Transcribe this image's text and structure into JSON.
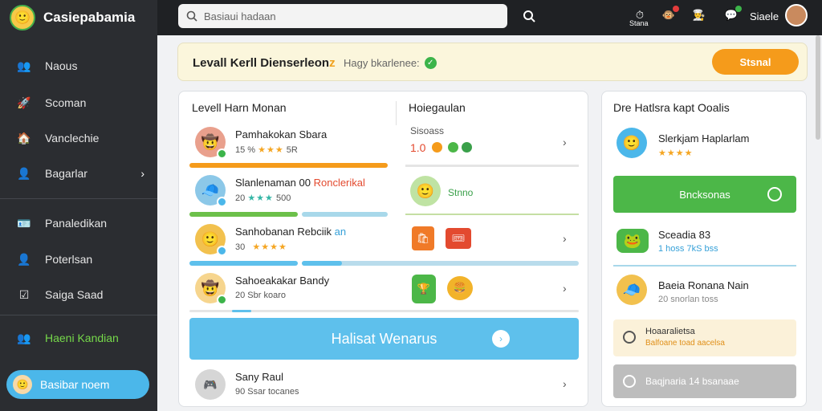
{
  "app": {
    "name": "Casiepabamia",
    "logo_icon": "mascot-logo-icon"
  },
  "sidebar": {
    "items": [
      {
        "label": "Naous",
        "icon": "users-icon",
        "glyph": "👥"
      },
      {
        "label": "Scoman",
        "icon": "rocket-icon",
        "glyph": "🚀"
      },
      {
        "label": "Vanclechie",
        "icon": "home-icon",
        "glyph": "🏠"
      },
      {
        "label": "Bagarlar",
        "icon": "user-icon",
        "glyph": "👤",
        "has_arrow": true
      },
      {
        "label": "Panaledikan",
        "icon": "profile-card-icon",
        "glyph": "🪪"
      },
      {
        "label": "Poterlsan",
        "icon": "person-icon",
        "glyph": "👤"
      },
      {
        "label": "Saiga Saad",
        "icon": "checklist-icon",
        "glyph": "☑"
      },
      {
        "label": "Haeni Kandian",
        "icon": "group-icon",
        "glyph": "👥",
        "active": true
      }
    ],
    "user_pill": {
      "label": "Basibar noem"
    }
  },
  "topbar": {
    "search_placeholder": "Basiaui hadaan",
    "icons": [
      {
        "name": "timer-icon",
        "label": "Stana"
      },
      {
        "name": "mascot-notification-icon",
        "badge": "#e33c3c"
      },
      {
        "name": "chef-icon"
      },
      {
        "name": "chat-icon",
        "badge": "#3cb44a"
      }
    ],
    "user_name": "Siaele"
  },
  "banner": {
    "title": "Levall Kerll Dienserleon",
    "title_suffix": "z",
    "subtitle": "Hagy bkarlenee:",
    "button": "Stsnal"
  },
  "levels": {
    "title": "Levell Harn Monan",
    "rows": [
      {
        "name": "Pamhakokan Sbara",
        "meta_left": "15 %",
        "meta_right": "5R",
        "stars": "★★★",
        "avatar": "#e9a08d",
        "badge": "#3cb44a"
      },
      {
        "name": "Slanlenaman 00",
        "name_accent": "Ronclerikal",
        "meta_left": "20",
        "meta_right": "500",
        "stars": "★★★",
        "stars_teal": true,
        "avatar": "#8cc8e8",
        "badge": "#4bb7ea"
      },
      {
        "name": "Sanhobanan Rebciik",
        "name_accent": "an",
        "meta_left": "30",
        "meta_right": "",
        "stars": "★★★★",
        "avatar": "#f2c14e",
        "badge": "#4bb7ea"
      },
      {
        "name": "Sahoeakakar Bandy",
        "meta_left": "20 Sbr koaro",
        "meta_right": "",
        "stars": "",
        "avatar": "#f6d58e",
        "badge": "#3cb44a"
      }
    ],
    "progress": [
      0.68,
      0.55,
      0.32,
      0.1
    ],
    "cta": "Halisat Wenarus",
    "extra_row": {
      "name": "Sany Raul",
      "meta": "90 Ssar tocanes"
    }
  },
  "middle": {
    "title": "Hoiegaulan",
    "label": "Sisoass",
    "value": "1.0",
    "tag": "Stnno"
  },
  "right": {
    "title": "Dre Hatlsra kapt Ooalis",
    "rows": [
      {
        "name": "Slerkjam Haplarlam",
        "stars": "★★★★",
        "avatar": "#4bb7ea"
      },
      {
        "name": "Sceadia 83",
        "meta": "1 hoss 7kS bss",
        "avatar": "#4cb748"
      },
      {
        "name": "Baeia Ronana Nain",
        "meta": "20 snorlan toss",
        "avatar": "#f2c14e"
      }
    ],
    "green_button": "Bncksonas",
    "notice_title": "Hoaaralietsa",
    "notice_sub": "Balfoane toad aacelsa",
    "gray_button": "Baqjnaria 14 bsanaae"
  },
  "colors": {
    "sidebar": "#2b2d31",
    "topbar": "#1f2124",
    "accent_orange": "#f59b1b",
    "accent_green": "#4cb748",
    "accent_blue": "#5ec0ec"
  }
}
